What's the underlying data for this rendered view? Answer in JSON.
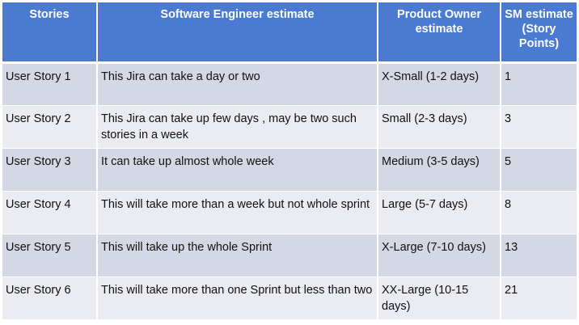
{
  "table": {
    "headers": [
      "Stories",
      "Software Engineer estimate",
      "Product Owner estimate",
      "SM estimate (Story Points)"
    ],
    "rows": [
      [
        "User Story 1",
        "This Jira can take a day or two",
        "X-Small (1-2 days)",
        "1"
      ],
      [
        "User Story 2",
        "This Jira can take up few days , may be two such stories in a week",
        "Small (2-3 days)",
        "3"
      ],
      [
        "User Story 3",
        "It can take up almost whole week",
        "Medium (3-5 days)",
        "5"
      ],
      [
        "User Story 4",
        "This will take more than a week but not whole sprint",
        "Large (5-7 days)",
        "8"
      ],
      [
        "User Story 5",
        "This will take up the whole Sprint",
        "X-Large (7-10 days)",
        "13"
      ],
      [
        "User Story 6",
        "This will take more than one Sprint but less than two",
        "XX-Large (10-15 days)",
        "21"
      ]
    ]
  },
  "colors": {
    "header_bg": "#4a7bd0",
    "row_dark": "#d3d8e4",
    "row_light": "#eaecf2"
  }
}
